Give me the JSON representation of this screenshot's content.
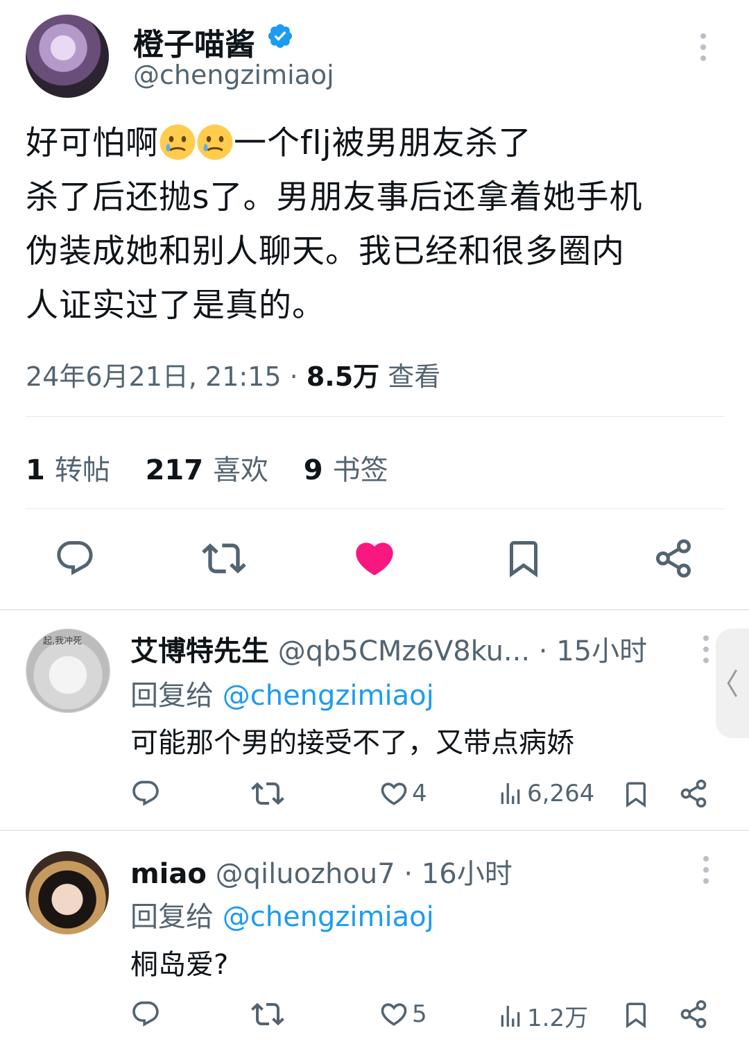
{
  "main_tweet": {
    "author_name": "橙子喵酱",
    "author_handle": "@chengzimiaoj",
    "text_part1": "好可怕啊",
    "text_part2": "一个flj被男朋友杀了\n杀了后还抛s了。男朋友事后还拿着她手机\n伪装成她和别人聊天。我已经和很多圈内\n人证实过了是真的。",
    "emoji": [
      "crying-face-emoji",
      "crying-face-emoji"
    ],
    "timestamp": "24年6月21日, 21:15",
    "separator": "·",
    "views_count": "8.5万",
    "views_label": "查看",
    "stats": {
      "reposts_count": "1",
      "reposts_label": "转帖",
      "likes_count": "217",
      "likes_label": "喜欢",
      "bookmarks_count": "9",
      "bookmarks_label": "书签"
    },
    "actions": [
      "reply-icon",
      "repost-icon",
      "like-icon",
      "bookmark-icon",
      "share-icon"
    ],
    "liked": true,
    "like_color": "#f91880"
  },
  "replies": [
    {
      "name": "艾博特先生",
      "handle": "@qb5CMz6V8ku...",
      "time": "· 15小时",
      "reply_to_label": "回复给",
      "reply_to_handle": "@chengzimiaoj",
      "text": "可能那个男的接受不了，又带点病娇",
      "avatar_caption": "起,我冲死",
      "likes": "4",
      "views": "6,264"
    },
    {
      "name": "miao",
      "handle": "@qiluozhou7",
      "time": "· 16小时",
      "reply_to_label": "回复给",
      "reply_to_handle": "@chengzimiaoj",
      "text": "桐岛爱?",
      "likes": "5",
      "views": "1.2万"
    }
  ],
  "colors": {
    "text": "#0f1419",
    "muted": "#536471",
    "link": "#1d9bf0",
    "verified": "#1d9bf0"
  }
}
